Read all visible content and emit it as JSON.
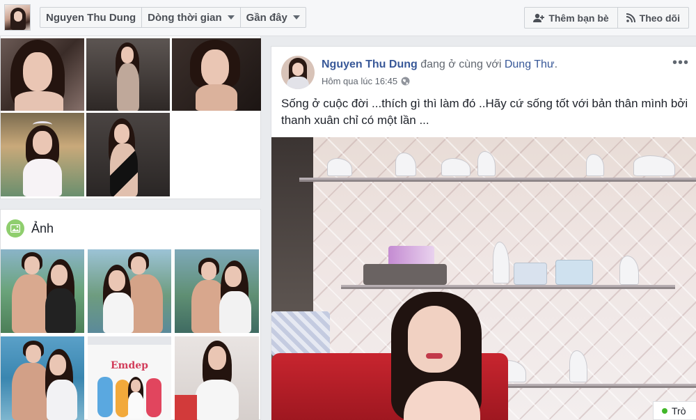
{
  "topbar": {
    "breadcrumb": [
      "Nguyen Thu Dung",
      "Dòng thời gian",
      "Gần đây"
    ],
    "add_friend_label": "Thêm bạn bè",
    "follow_label": "Theo dõi"
  },
  "photos_section": {
    "title": "Ảnh"
  },
  "post": {
    "author": "Nguyen Thu Dung",
    "with_text": "đang ở cùng với",
    "tagged": "Dung Thư",
    "period": ".",
    "time": "Hôm qua lúc 16:45",
    "privacy_icon": "globe-icon",
    "more_label": "•••",
    "text": "Sống ở cuộc đời ...thích gì thì làm đó ..Hãy cứ sống tốt với bản thân mình bởi thanh xuân chỉ có một lần ..."
  },
  "thumbnail_text": {
    "magazine_title": "Emdep"
  },
  "chat": {
    "label": "Trò"
  },
  "colors": {
    "link": "#385898",
    "page_bg": "#e9ebee",
    "online": "#42b72a"
  }
}
